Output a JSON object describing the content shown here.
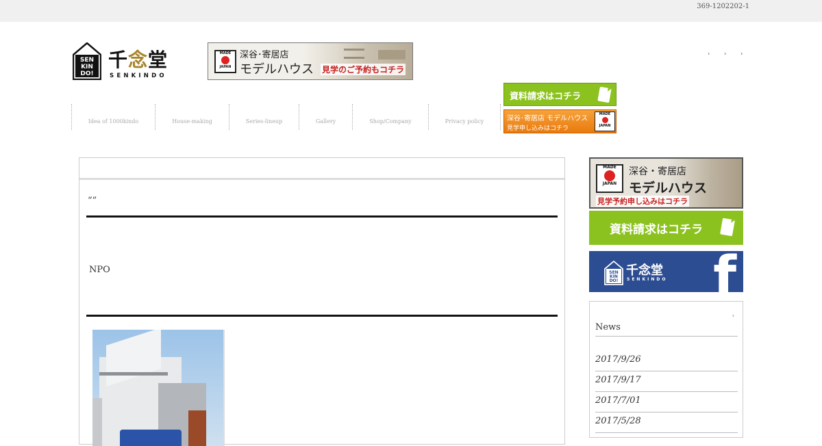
{
  "topbar": {
    "postal": "369-1202202-1"
  },
  "logo": {
    "house_text": [
      "SEN",
      "KIN",
      "DO!"
    ],
    "kanji_1": "千",
    "kanji_2": "念",
    "kanji_3": "堂",
    "roman": "SENKINDO"
  },
  "banner_top": {
    "made": "MADE",
    "japan": "JAPAN",
    "line1": "深谷･寄居店",
    "line2": "モデルハウス",
    "line3": "見学のご予約もコチラ"
  },
  "small_links": [
    "›",
    "›",
    "›"
  ],
  "nav": [
    {
      "label": "Idea of 1000kindo",
      "w": 122
    },
    {
      "label": "House-making",
      "w": 108
    },
    {
      "label": "Series-lineup",
      "w": 102
    },
    {
      "label": "Gallery",
      "w": 78
    },
    {
      "label": "Shop/Company",
      "w": 111
    },
    {
      "label": "Privacy policy",
      "w": 106
    }
  ],
  "header_btns": {
    "request": "資料請求はコチラ",
    "model_line1": "深谷･寄居店 モデルハウス",
    "model_line2": "見学申し込みはコチラ",
    "made": "MADE",
    "japan": "JAPAN"
  },
  "main": {
    "title": "“”",
    "para": "NPO"
  },
  "side": {
    "banner1": {
      "made": "MADE",
      "japan": "JAPAN",
      "line1": "深谷・寄居店",
      "line2": "モデルハウス",
      "line3": "見学予約申し込みはコチラ"
    },
    "banner2": {
      "label": "資料請求はコチラ"
    },
    "banner3": {
      "house_text": [
        "SEN",
        "KIN",
        "DO!"
      ],
      "kanji": "千念堂",
      "roman": "SENKINDO",
      "fb": "f"
    }
  },
  "news": {
    "arrow": "›",
    "title": "News",
    "dates": [
      "2017/9/26",
      "2017/9/17",
      "2017/7/01",
      "2017/5/28"
    ]
  }
}
